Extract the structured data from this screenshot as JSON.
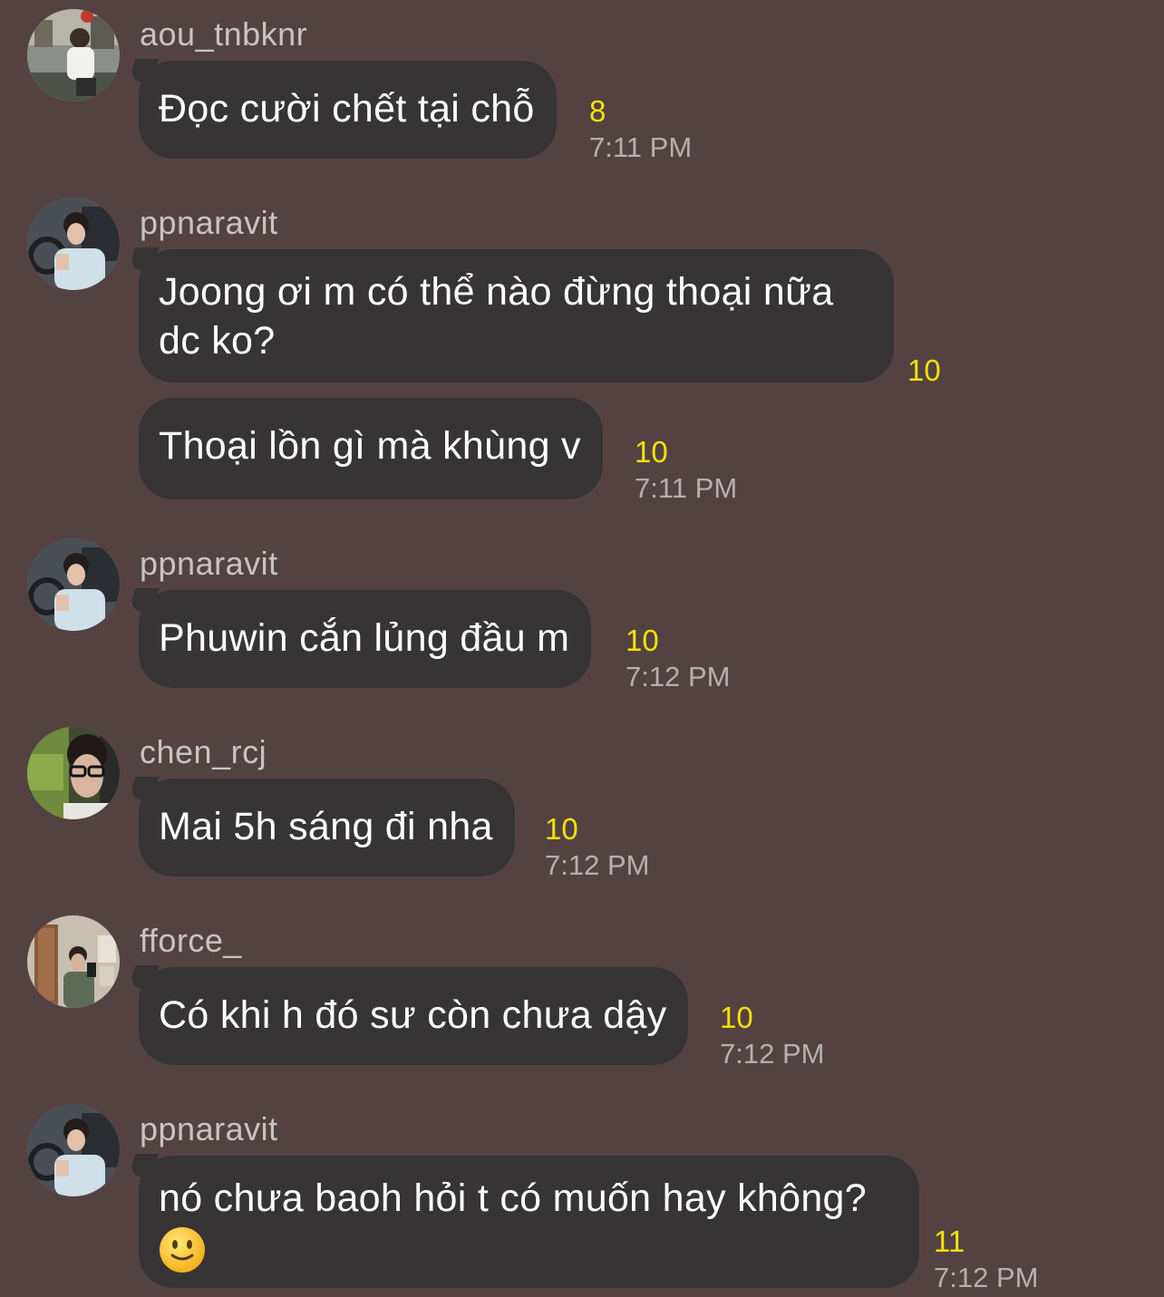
{
  "messages": [
    {
      "username": "aou_tnbknr",
      "bubbles": [
        {
          "text": "Đọc cười chết tại chỗ",
          "read_count": "8",
          "time": "7:11 PM"
        }
      ]
    },
    {
      "username": "ppnaravit",
      "bubbles": [
        {
          "line1": "Joong ơi m có thể nào đừng thoại nữa",
          "line2": "dc ko?",
          "read_count": "10",
          "time": ""
        },
        {
          "text": "Thoại lồn gì mà khùng v",
          "read_count": "10",
          "time": "7:11 PM"
        }
      ]
    },
    {
      "username": "ppnaravit",
      "bubbles": [
        {
          "text": "Phuwin cắn lủng đầu m",
          "read_count": "10",
          "time": "7:12 PM"
        }
      ]
    },
    {
      "username": "chen_rcj",
      "bubbles": [
        {
          "text": "Mai 5h sáng đi nha",
          "read_count": "10",
          "time": "7:12 PM"
        }
      ]
    },
    {
      "username": "fforce_",
      "bubbles": [
        {
          "text": "Có khi h đó sư còn chưa dậy",
          "read_count": "10",
          "time": "7:12 PM"
        }
      ]
    },
    {
      "username": "ppnaravit",
      "bubbles": [
        {
          "line1": "nó chưa baoh hỏi t có muốn hay không?",
          "emoji": "slightly-smiling-face-emoji",
          "read_count": "11",
          "time": "7:12 PM"
        }
      ]
    }
  ],
  "colors": {
    "background": "#544243",
    "bubble": "#363435",
    "read_count": "#f5e200",
    "time": "#b7afaf",
    "username": "#c9c3c3"
  },
  "icons": [
    "avatar-photo",
    "slightly-smiling-face-emoji"
  ]
}
